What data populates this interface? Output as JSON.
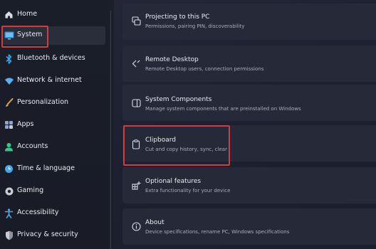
{
  "sidebar": {
    "items": [
      {
        "label": "Home",
        "icon": "home-icon",
        "color": "#d9dbe2"
      },
      {
        "label": "System",
        "icon": "system-display-icon",
        "color": "#3aa0e8"
      },
      {
        "label": "Bluetooth & devices",
        "icon": "bluetooth-icon",
        "color": "#3aa0e8"
      },
      {
        "label": "Network & internet",
        "icon": "network-icon",
        "color": "#5bb1ef"
      },
      {
        "label": "Personalization",
        "icon": "brush-icon",
        "color": "#e3a35a"
      },
      {
        "label": "Apps",
        "icon": "apps-icon",
        "color": "#8fa4c8"
      },
      {
        "label": "Accounts",
        "icon": "accounts-icon",
        "color": "#3cc48b"
      },
      {
        "label": "Time & language",
        "icon": "globe-clock-icon",
        "color": "#4aa8e8"
      },
      {
        "label": "Gaming",
        "icon": "gaming-icon",
        "color": "#c9ccd4"
      },
      {
        "label": "Accessibility",
        "icon": "accessibility-icon",
        "color": "#4aa8e8"
      },
      {
        "label": "Privacy & security",
        "icon": "shield-icon",
        "color": "#c9ccd4"
      }
    ],
    "selected_index": 1
  },
  "settings": {
    "cards": [
      {
        "title": "Projecting to this PC",
        "desc": "Permissions, pairing PIN, discoverability",
        "icon": "projecting-icon"
      },
      {
        "title": "Remote Desktop",
        "desc": "Remote Desktop users, connection permissions",
        "icon": "remote-desktop-icon"
      },
      {
        "title": "System Components",
        "desc": "Manage system components that are preinstalled on Windows",
        "icon": "system-components-icon"
      },
      {
        "title": "Clipboard",
        "desc": "Cut and copy history, sync, clear",
        "icon": "clipboard-icon"
      },
      {
        "title": "Optional features",
        "desc": "Extra functionality for your device",
        "icon": "optional-features-icon"
      },
      {
        "title": "About",
        "desc": "Device specifications, rename PC, Windows specifications",
        "icon": "about-icon"
      }
    ]
  },
  "colors": {
    "highlight": "#d33b40",
    "background": "#1b1f2b",
    "card": "#262a38"
  }
}
